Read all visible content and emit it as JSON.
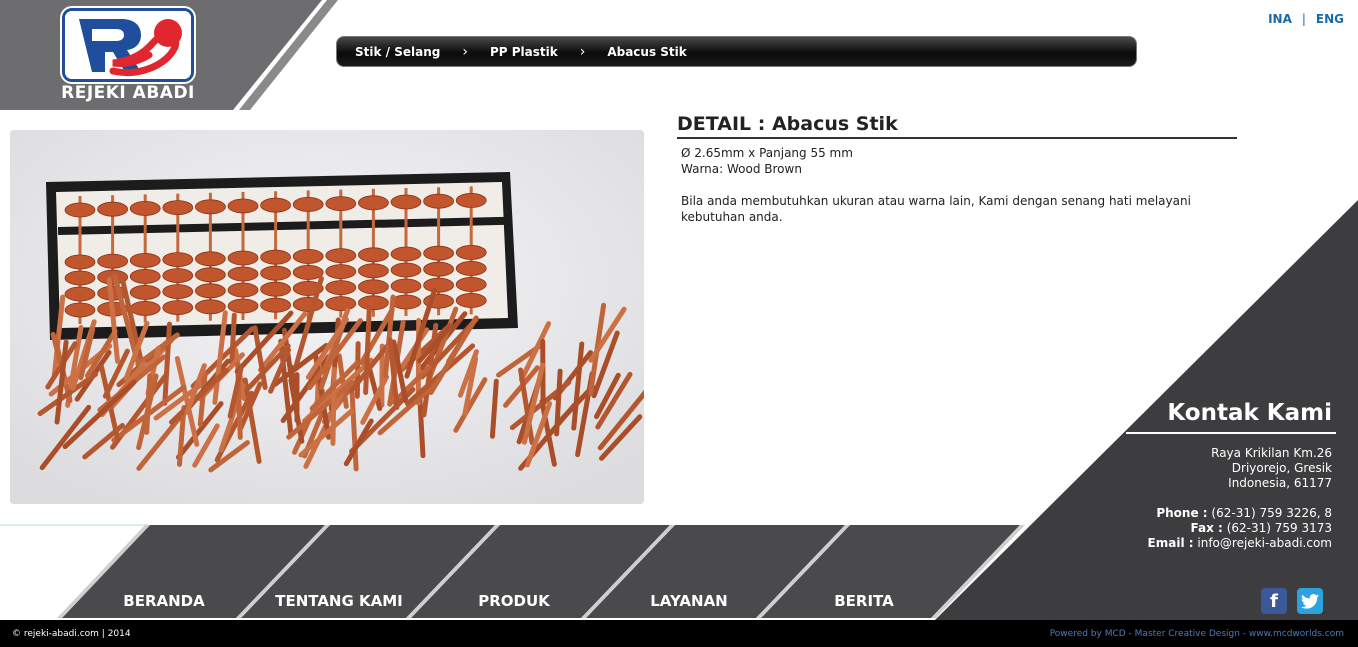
{
  "header": {
    "logo_text": "REJEKI ABADI",
    "logo_mark": "RS",
    "lang": {
      "ina": "INA",
      "separator": "|",
      "eng": "ENG"
    }
  },
  "breadcrumb": {
    "items": [
      "Stik / Selang",
      "PP Plastik",
      "Abacus Stik"
    ],
    "separator": "›"
  },
  "product": {
    "image_alt": "abacus-and-sticks",
    "title": "DETAIL : Abacus Stik",
    "spec_size": "Ø 2.65mm x Panjang 55 mm",
    "spec_color": "Warna: Wood Brown",
    "note": "Bila anda membutuhkan ukuran atau warna lain, Kami dengan senang hati melayani kebutuhan anda."
  },
  "contact": {
    "title": "Kontak Kami",
    "address_line1": "Raya Krikilan Km.26",
    "address_line2": "Driyorejo, Gresik",
    "address_line3": "Indonesia, 61177",
    "phone_label": "Phone :",
    "phone_value": "(62-31) 759 3226, 8",
    "fax_label": "Fax :",
    "fax_value": "(62-31) 759 3173",
    "email_label": "Email :",
    "email_value": "info@rejeki-abadi.com"
  },
  "social": {
    "facebook": "f",
    "twitter": "t"
  },
  "nav": [
    "BERANDA",
    "TENTANG KAMI",
    "PRODUK",
    "LAYANAN",
    "BERITA"
  ],
  "footer": {
    "copyright": "© rejeki-abadi.com | 2014",
    "powered": "Powered by MCD - Master Creative Design - www.mcdworlds.com"
  },
  "colors": {
    "dark_panel": "#3d3d3f",
    "nav_block": "#4a4a4c",
    "link_blue": "#1a6aa8",
    "bead_orange": "#c1552e"
  }
}
